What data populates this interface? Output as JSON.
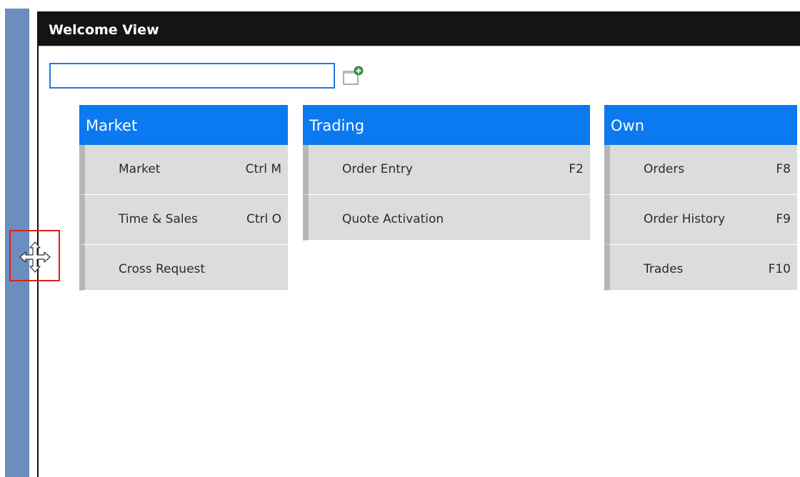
{
  "window": {
    "title": "Welcome View"
  },
  "search": {
    "value": "",
    "placeholder": ""
  },
  "icons": {
    "add_view": "add-window-icon",
    "move_cursor": "move-cursor-icon"
  },
  "colors": {
    "header_blue": "#0b79f0",
    "title_bar": "#141414",
    "sidebar": "#6a8ebf",
    "item_bg": "#dcdcdc",
    "highlight": "#e21d1d"
  },
  "groups": [
    {
      "name": "Market",
      "items": [
        {
          "label": "Market",
          "shortcut": "Ctrl M"
        },
        {
          "label": "Time & Sales",
          "shortcut": "Ctrl O"
        },
        {
          "label": "Cross Request",
          "shortcut": ""
        }
      ]
    },
    {
      "name": "Trading",
      "items": [
        {
          "label": "Order Entry",
          "shortcut": "F2"
        },
        {
          "label": "Quote Activation",
          "shortcut": ""
        }
      ]
    },
    {
      "name": "Own",
      "items": [
        {
          "label": "Orders",
          "shortcut": "F8"
        },
        {
          "label": "Order History",
          "shortcut": "F9"
        },
        {
          "label": "Trades",
          "shortcut": "F10"
        }
      ]
    }
  ]
}
